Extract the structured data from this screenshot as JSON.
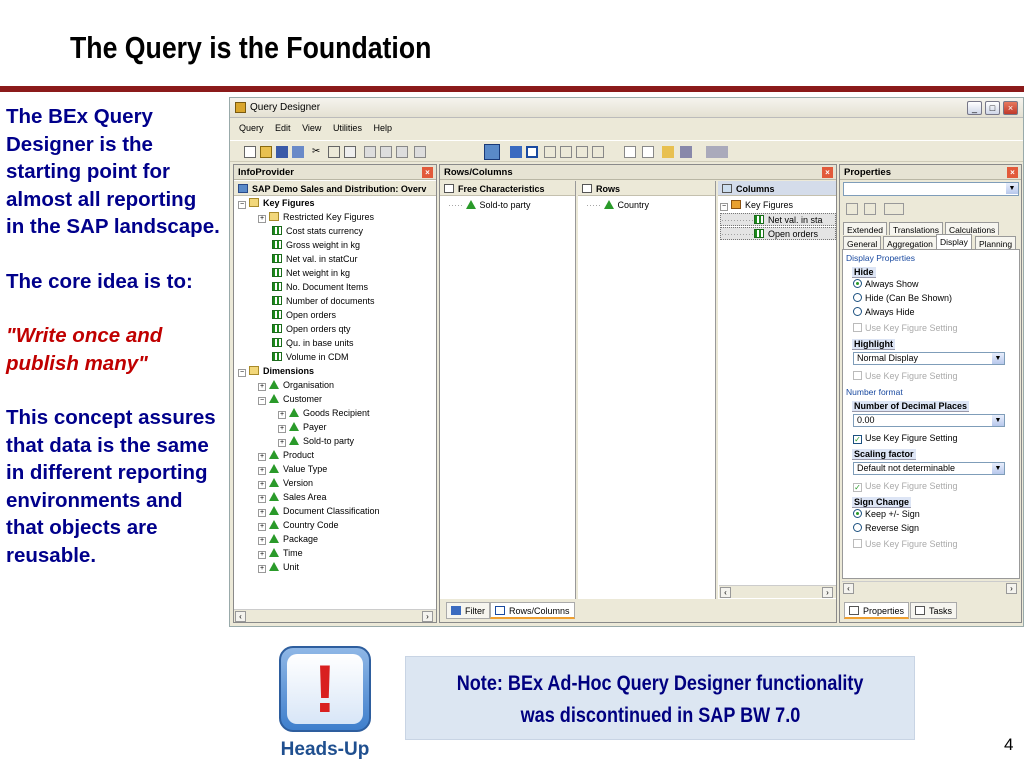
{
  "slide": {
    "title": "The Query is the Foundation",
    "para1": "The BEx Query Designer is the starting point for almost all reporting in the SAP landscape.",
    "para2": "The core idea is to:",
    "quote": "\"Write once and publish many\"",
    "para3": "This concept assures that data is the same in different reporting environments and that objects are reusable.",
    "note_line1": "Note: BEx Ad-Hoc Query Designer functionality",
    "note_line2": "was discontinued in SAP BW 7.0",
    "headsup_label": "Heads-Up",
    "headsup_glyph": "!",
    "page_number": "4"
  },
  "window": {
    "title": "Query Designer",
    "menu": [
      "Query",
      "Edit",
      "View",
      "Utilities",
      "Help"
    ]
  },
  "infoprovider": {
    "header": "InfoProvider",
    "root": "SAP Demo Sales and Distribution: Overv",
    "key_figures_label": "Key Figures",
    "key_figures": [
      "Restricted Key Figures",
      "Cost stats currency",
      "Gross weight in kg",
      "Net val. in statCur",
      "Net weight in kg",
      "No. Document Items",
      "Number of documents",
      "Open orders",
      "Open orders qty",
      "Qu. in base units",
      "Volume in CDM"
    ],
    "dimensions_label": "Dimensions",
    "dimensions": [
      "Organisation",
      "Customer",
      "Goods Recipient",
      "Payer",
      "Sold-to party",
      "Product",
      "Value Type",
      "Version",
      "Sales Area",
      "Document Classification",
      "Country Code",
      "Package",
      "Time",
      "Unit"
    ]
  },
  "rows_columns": {
    "header": "Rows/Columns",
    "free_header": "Free Characteristics",
    "free_items": [
      "Sold-to party"
    ],
    "rows_header": "Rows",
    "rows_items": [
      "Country"
    ],
    "columns_header": "Columns",
    "columns_root": "Key Figures",
    "columns_items": [
      "Net val. in sta",
      "Open orders"
    ],
    "tabs": [
      "Filter",
      "Rows/Columns"
    ]
  },
  "properties": {
    "header": "Properties",
    "tabs_row1": [
      "Extended",
      "Translations",
      "Calculations"
    ],
    "tabs_row2": [
      "General",
      "Aggregation",
      "Display",
      "Planning"
    ],
    "display_properties": "Display Properties",
    "hide_label": "Hide",
    "hide_options": [
      "Always Show",
      "Hide (Can Be Shown)",
      "Always Hide"
    ],
    "use_kf_setting": "Use Key Figure Setting",
    "highlight_label": "Highlight",
    "highlight_value": "Normal Display",
    "number_format": "Number format",
    "decimal_label": "Number of Decimal Places",
    "decimal_value": "0.00",
    "scaling_label": "Scaling factor",
    "scaling_value": "Default not determinable",
    "sign_label": "Sign Change",
    "sign_options": [
      "Keep +/- Sign",
      "Reverse Sign"
    ],
    "bottom_tabs": [
      "Properties",
      "Tasks"
    ]
  }
}
